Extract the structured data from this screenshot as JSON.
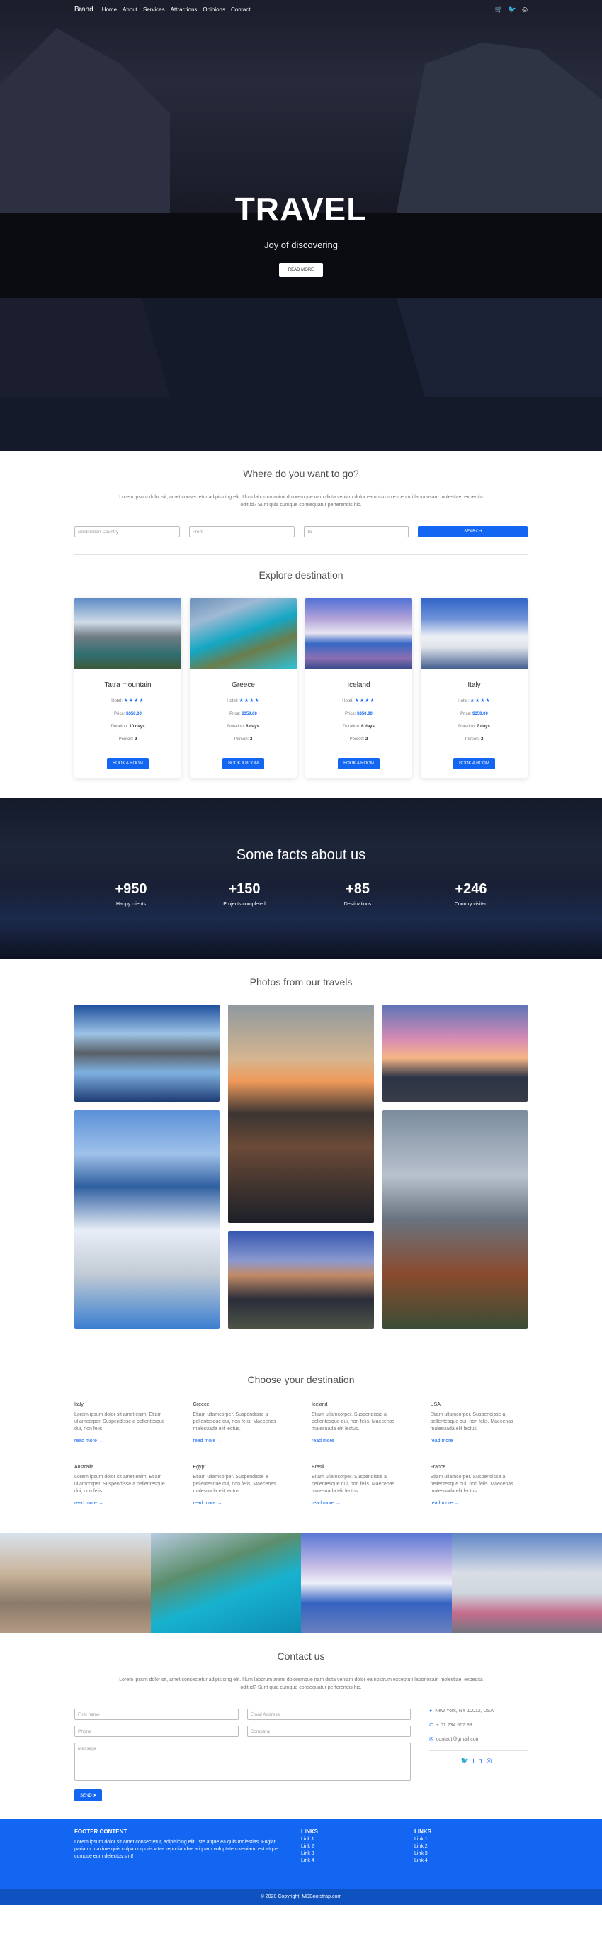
{
  "nav": {
    "brand": "Brand",
    "links": [
      "Home",
      "About",
      "Services",
      "Attractions",
      "Opinions",
      "Contact"
    ],
    "icons": [
      "cart-icon",
      "twitter-icon",
      "instagram-icon"
    ]
  },
  "hero": {
    "title": "TRAVEL",
    "subtitle": "Joy of discovering",
    "button": "READ MORE"
  },
  "search": {
    "title": "Where do you want to go?",
    "lead": "Lorem ipsum dolor sit, amet consectetur adipisicing elit. Illum laborum animi doloremque nam dicta veniam dolor ea nostrum excepturi laboriosam molestiae, expedita odit id? Sunt quia cumque consequatur perferendis hic.",
    "destination_placeholder": "Destination Country",
    "from_placeholder": "From",
    "to_placeholder": "To",
    "button": "SEARCH"
  },
  "explore": {
    "title": "Explore destination",
    "cards": [
      {
        "name": "Tatra mountain",
        "hotel_label": "Hotel:",
        "stars": "★★★★",
        "price_label": "Price:",
        "price": "$350.00",
        "duration_label": "Duration:",
        "duration": "10 days",
        "person_label": "Person:",
        "person": "2",
        "button": "BOOK A ROOM"
      },
      {
        "name": "Greece",
        "hotel_label": "Hotel:",
        "stars": "★★★★",
        "price_label": "Price:",
        "price": "$350.00",
        "duration_label": "Duration:",
        "duration": "6 days",
        "person_label": "Person:",
        "person": "2",
        "button": "BOOK A ROOM"
      },
      {
        "name": "Iceland",
        "hotel_label": "Hotel:",
        "stars": "★★★★",
        "price_label": "Price:",
        "price": "$350.00",
        "duration_label": "Duration:",
        "duration": "6 days",
        "person_label": "Person:",
        "person": "2",
        "button": "BOOK A ROOM"
      },
      {
        "name": "Italy",
        "hotel_label": "Hotel:",
        "stars": "★★★★",
        "price_label": "Price:",
        "price": "$350.00",
        "duration_label": "Duration:",
        "duration": "7 days",
        "person_label": "Person:",
        "person": "2",
        "button": "BOOK A ROOM"
      }
    ]
  },
  "facts": {
    "title": "Some facts about us",
    "items": [
      {
        "value": "+950",
        "label": "Happy clients"
      },
      {
        "value": "+150",
        "label": "Projects completed"
      },
      {
        "value": "+85",
        "label": "Destinations"
      },
      {
        "value": "+246",
        "label": "Country visited"
      }
    ]
  },
  "photos": {
    "title": "Photos from our travels"
  },
  "choose": {
    "title": "Choose your destination",
    "items": [
      {
        "name": "Italy",
        "text": "Lorem ipsum dolor sit amet enim. Etiam ullamcorper. Suspendisse a pellentesque dui, non felis.",
        "more": "read more"
      },
      {
        "name": "Greece",
        "text": "Etiam ullamcorper. Suspendisse a pellentesque dui, non felis. Maecenas malesuada elit lectus.",
        "more": "read more"
      },
      {
        "name": "Iceland",
        "text": "Etiam ullamcorper. Suspendisse a pellentesque dui, non felis. Maecenas malesuada elit lectus.",
        "more": "read more"
      },
      {
        "name": "USA",
        "text": "Etiam ullamcorper. Suspendisse a pellentesque dui, non felis. Maecenas malesuada elit lectus.",
        "more": "read more"
      },
      {
        "name": "Australia",
        "text": "Lorem ipsum dolor sit amet enim. Etiam ullamcorper. Suspendisse a pellentesque dui, non felis.",
        "more": "read more"
      },
      {
        "name": "Egypt",
        "text": "Etiam ullamcorper. Suspendisse a pellentesque dui, non felis. Maecenas malesuada elit lectus.",
        "more": "read more"
      },
      {
        "name": "Brasil",
        "text": "Etiam ullamcorper. Suspendisse a pellentesque dui, non felis. Maecenas malesuada elit lectus.",
        "more": "read more"
      },
      {
        "name": "France",
        "text": "Etiam ullamcorper. Suspendisse a pellentesque dui, non felis. Maecenas malesuada elit lectus.",
        "more": "read more"
      }
    ]
  },
  "contact": {
    "title": "Contact us",
    "lead": "Lorem ipsum dolor sit, amet consectetur adipisicing elit. Illum laborum animi doloremque nam dicta veniam dolor ea nostrum excepturi laboriosam molestiae, expedita odit id? Sunt quia cumque consequatur perferendis hic.",
    "first_name": "First name",
    "email": "Email Address",
    "phone": "Phone",
    "company": "Company",
    "message": "Message",
    "send": "SEND",
    "address": "New York, NY 10012, USA",
    "phone_number": "+ 01 234 567 89",
    "email_address": "contact@gmail.com"
  },
  "footer": {
    "heading": "FOOTER CONTENT",
    "text": "Lorem ipsum dolor sit amet consectetur, adipisicing elit. Iste atque ea quis molestias. Fugiat pariatur maxime quis culpa corporis vitae repudiandae aliquam voluptatem veniam, est atque cumque eum delectus sint!",
    "links1_title": "LINKS",
    "links1": [
      "Link 1",
      "Link 2",
      "Link 3",
      "Link 4"
    ],
    "links2_title": "LINKS",
    "links2": [
      "Link 1",
      "Link 2",
      "Link 3",
      "Link 4"
    ],
    "copyright": "© 2020 Copyright: MDBootstrap.com"
  }
}
